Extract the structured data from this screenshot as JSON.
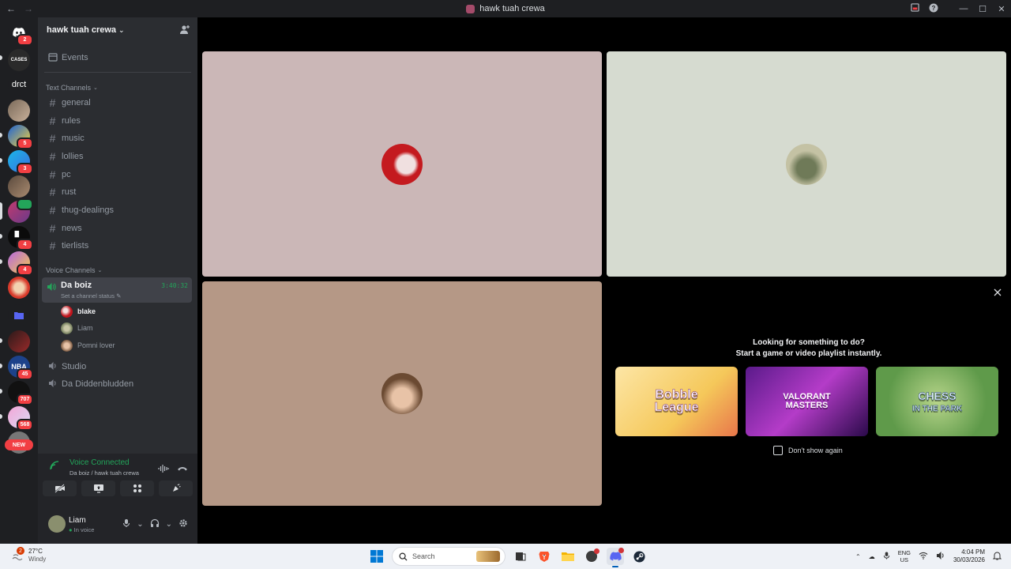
{
  "window": {
    "title": "hawk tuah crewa",
    "back_icon": "arrow-left-icon",
    "forward_icon": "arrow-right-icon"
  },
  "rail": {
    "servers": [
      {
        "name": "home",
        "badge": "2"
      },
      {
        "name": "cases",
        "label": "CASES"
      },
      {
        "name": "drct",
        "label": "drct"
      },
      {
        "name": "server-4"
      },
      {
        "name": "server-5",
        "badge": "5"
      },
      {
        "name": "server-6",
        "badge": "3"
      },
      {
        "name": "server-7"
      },
      {
        "name": "server-8"
      },
      {
        "name": "server-9",
        "badge": "4"
      },
      {
        "name": "server-10",
        "badge": "4"
      },
      {
        "name": "server-11"
      },
      {
        "name": "folder"
      },
      {
        "name": "server-13"
      },
      {
        "name": "nba",
        "label": "NBA",
        "badge": "45"
      },
      {
        "name": "server-15",
        "badge": "707"
      },
      {
        "name": "server-16",
        "badge": "568"
      },
      {
        "name": "server-17"
      }
    ],
    "new_label": "NEW"
  },
  "server": {
    "name": "hawk tuah crewa",
    "events_label": "Events",
    "text_category": "Text Channels",
    "text_channels": [
      "general",
      "rules",
      "music",
      "lollies",
      "pc",
      "rust",
      "thug-dealings",
      "news",
      "tierlists"
    ],
    "voice_category": "Voice Channels",
    "active_voice": {
      "name": "Da boiz",
      "status": "Set a channel status",
      "timer": "3:40:32",
      "users": [
        "blake",
        "Liam",
        "Pomni lover"
      ]
    },
    "other_voice_channels": [
      "Studio",
      "Da Diddenbludden"
    ]
  },
  "voice_panel": {
    "status": "Voice Connected",
    "location": "Da boiz / hawk tuah crewa"
  },
  "user_panel": {
    "name": "Liam",
    "status": "In voice"
  },
  "activity": {
    "line1": "Looking for something to do?",
    "line2": "Start a game or video playlist instantly.",
    "cards": [
      {
        "title_top": "Bobble",
        "title_bottom": "League"
      },
      {
        "title_top": "VALORANT",
        "title_bottom": "MASTERS"
      },
      {
        "title_top": "CHESS",
        "title_bottom": "IN THE PARK"
      }
    ],
    "dont_show": "Don't show again"
  },
  "taskbar": {
    "weather_badge": "2",
    "temp": "27°C",
    "condition": "Windy",
    "search": "Search",
    "lang_top": "ENG",
    "lang_bottom": "US",
    "time": "4:04 PM",
    "date": "30/03/2026"
  },
  "colors": {
    "tile_blake": "#cbb7b7",
    "tile_liam": "#d6dbd0",
    "tile_pomni": "#b59886",
    "green": "#23a55a",
    "red": "#f23f43"
  }
}
